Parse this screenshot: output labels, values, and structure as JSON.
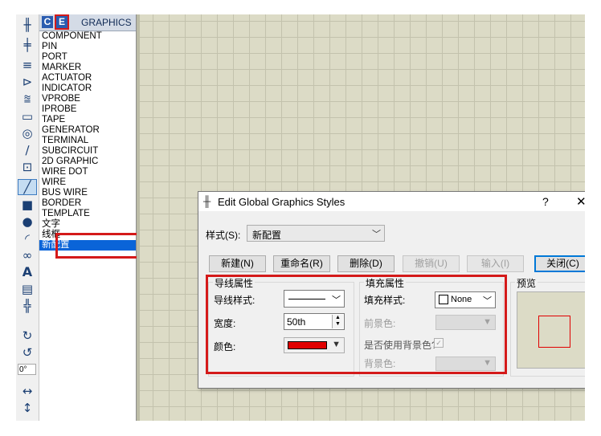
{
  "toolbar": {
    "icons": [
      "wire-tool-icon",
      "component-tool-icon",
      "bus-tool-icon",
      "pin-tool-icon",
      "graph-tool-icon",
      "tape-tool-icon",
      "generator-tool-icon",
      "probe-tool-icon",
      "instrument-tool-icon",
      "line-tool-icon",
      "box-tool-icon",
      "circle-tool-icon",
      "arc-tool-icon",
      "path-tool-icon",
      "text-tool-icon",
      "symbol-tool-icon",
      "marker-tool-icon",
      "rotate-cw-icon",
      "rotate-ccw-icon",
      "flip-horizontal-icon",
      "flip-vertical-icon"
    ],
    "text_tool": "A",
    "angle_value": "0°"
  },
  "panel": {
    "btn_c": "C",
    "btn_e": "E",
    "title": "GRAPHICS",
    "items": [
      "COMPONENT",
      "PIN",
      "PORT",
      "MARKER",
      "ACTUATOR",
      "INDICATOR",
      "VPROBE",
      "IPROBE",
      "TAPE",
      "GENERATOR",
      "TERMINAL",
      "SUBCIRCUIT",
      "2D GRAPHIC",
      "WIRE DOT",
      "WIRE",
      "BUS WIRE",
      "BORDER",
      "TEMPLATE",
      "文字",
      "线框",
      "新配置"
    ],
    "selected_index": 20
  },
  "dialog": {
    "title": "Edit Global Graphics Styles",
    "help": "?",
    "close": "✕",
    "style_label": "样式(S):",
    "style_value": "新配置",
    "buttons": {
      "new": "新建(N)",
      "rename": "重命名(R)",
      "delete": "删除(D)",
      "undo": "撤销(U)",
      "import": "输入(I)",
      "close": "关闭(C)"
    },
    "line_group": {
      "title": "导线属性",
      "style_label": "导线样式:",
      "width_label": "宽度:",
      "width_value": "50th",
      "color_label": "颜色:",
      "color": "#e00000"
    },
    "fill_group": {
      "title": "填充属性",
      "style_label": "填充样式:",
      "style_value": "None",
      "fg_label": "前景色:",
      "use_bg_label": "是否使用背景色?",
      "bg_label": "背景色:"
    },
    "preview_title": "预览"
  },
  "colors": {
    "highlight_red": "#d41a1a",
    "selection_blue": "#0a64d8",
    "canvas": "#dcdbc6"
  }
}
